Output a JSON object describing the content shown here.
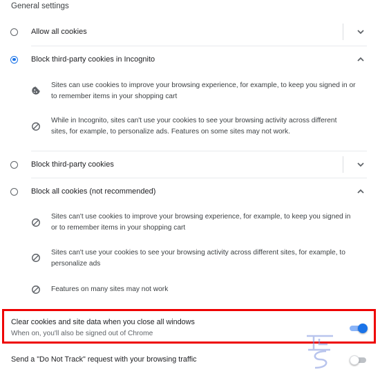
{
  "section_title": "General settings",
  "options": [
    {
      "label": "Allow all cookies",
      "selected": false,
      "expanded": false
    },
    {
      "label": "Block third-party cookies in Incognito",
      "selected": true,
      "expanded": true
    },
    {
      "label": "Block third-party cookies",
      "selected": false,
      "expanded": false
    },
    {
      "label": "Block all cookies (not recommended)",
      "selected": false,
      "expanded": true
    }
  ],
  "incognito_details": [
    {
      "icon": "cookie-icon",
      "text_1": "Sites can use cookies to improve your browsing experience, for example, to keep you signed in or",
      "text_2": "to remember items in your shopping cart"
    },
    {
      "icon": "block-icon",
      "text_1": "While in Incognito, sites can't use your cookies to see your browsing activity across different",
      "text_2": "sites, for example, to personalize ads. Features on some sites may not work."
    }
  ],
  "block_all_details": [
    {
      "icon": "block-icon",
      "text_1": "Sites can't use cookies to improve your browsing experience, for example, to keep you signed in",
      "text_2": "or to remember items in your shopping cart"
    },
    {
      "icon": "block-icon",
      "text_1": "Sites can't use your cookies to see your browsing activity across different sites, for example, to",
      "text_2": "personalize ads"
    },
    {
      "icon": "block-icon",
      "text_1": "Features on many sites may not work"
    }
  ],
  "clear_on_exit": {
    "title": "Clear cookies and site data when you close all windows",
    "subtitle": "When on, you'll also be signed out of Chrome",
    "enabled": true
  },
  "do_not_track": {
    "title": "Send a \"Do Not Track\" request with your browsing traffic",
    "enabled": false
  },
  "colors": {
    "accent": "#1a73e8",
    "highlight": "#ee0000"
  }
}
